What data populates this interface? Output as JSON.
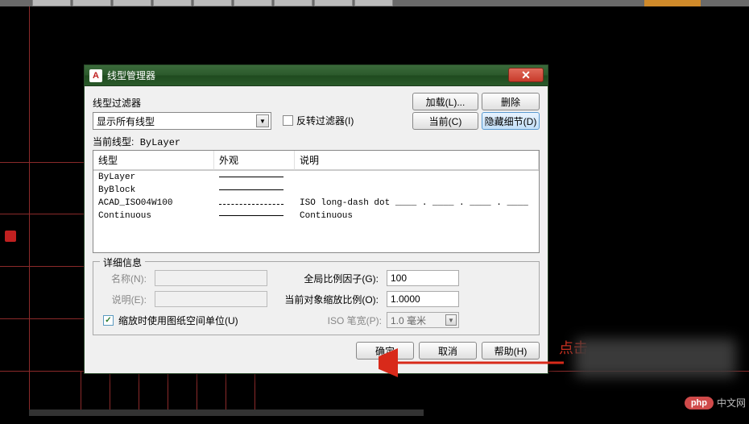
{
  "dialog": {
    "title": "线型管理器",
    "filter": {
      "label": "线型过滤器",
      "value": "显示所有线型",
      "invert_label": "反转过滤器(I)"
    },
    "buttons": {
      "load": "加载(L)...",
      "delete": "删除",
      "current": "当前(C)",
      "hide_details": "隐藏细节(D)"
    },
    "current_line": {
      "label": "当前线型:",
      "value": "ByLayer"
    },
    "columns": {
      "type": "线型",
      "look": "外观",
      "desc": "说明"
    },
    "rows": [
      {
        "type": "ByLayer",
        "look": "solid",
        "desc": ""
      },
      {
        "type": "ByBlock",
        "look": "solid",
        "desc": ""
      },
      {
        "type": "ACAD_ISO04W100",
        "look": "dashdot",
        "desc": "ISO long-dash dot ____ . ____ . ____ . ____"
      },
      {
        "type": "Continuous",
        "look": "solid",
        "desc": "Continuous"
      }
    ],
    "details": {
      "legend": "详细信息",
      "name_label": "名称(N):",
      "desc_label": "说明(E):",
      "global_scale_label": "全局比例因子(G):",
      "global_scale_value": "100",
      "obj_scale_label": "当前对象缩放比例(O):",
      "obj_scale_value": "1.0000",
      "iso_pen_label": "ISO 笔宽(P):",
      "iso_pen_value": "1.0 毫米",
      "paper_scale_label": "缩放时使用图纸空间单位(U)"
    },
    "footer": {
      "ok": "确定",
      "cancel": "取消",
      "help": "帮助(H)"
    }
  },
  "annotation": "点击",
  "watermark": {
    "badge": "php",
    "text": "中文网"
  }
}
